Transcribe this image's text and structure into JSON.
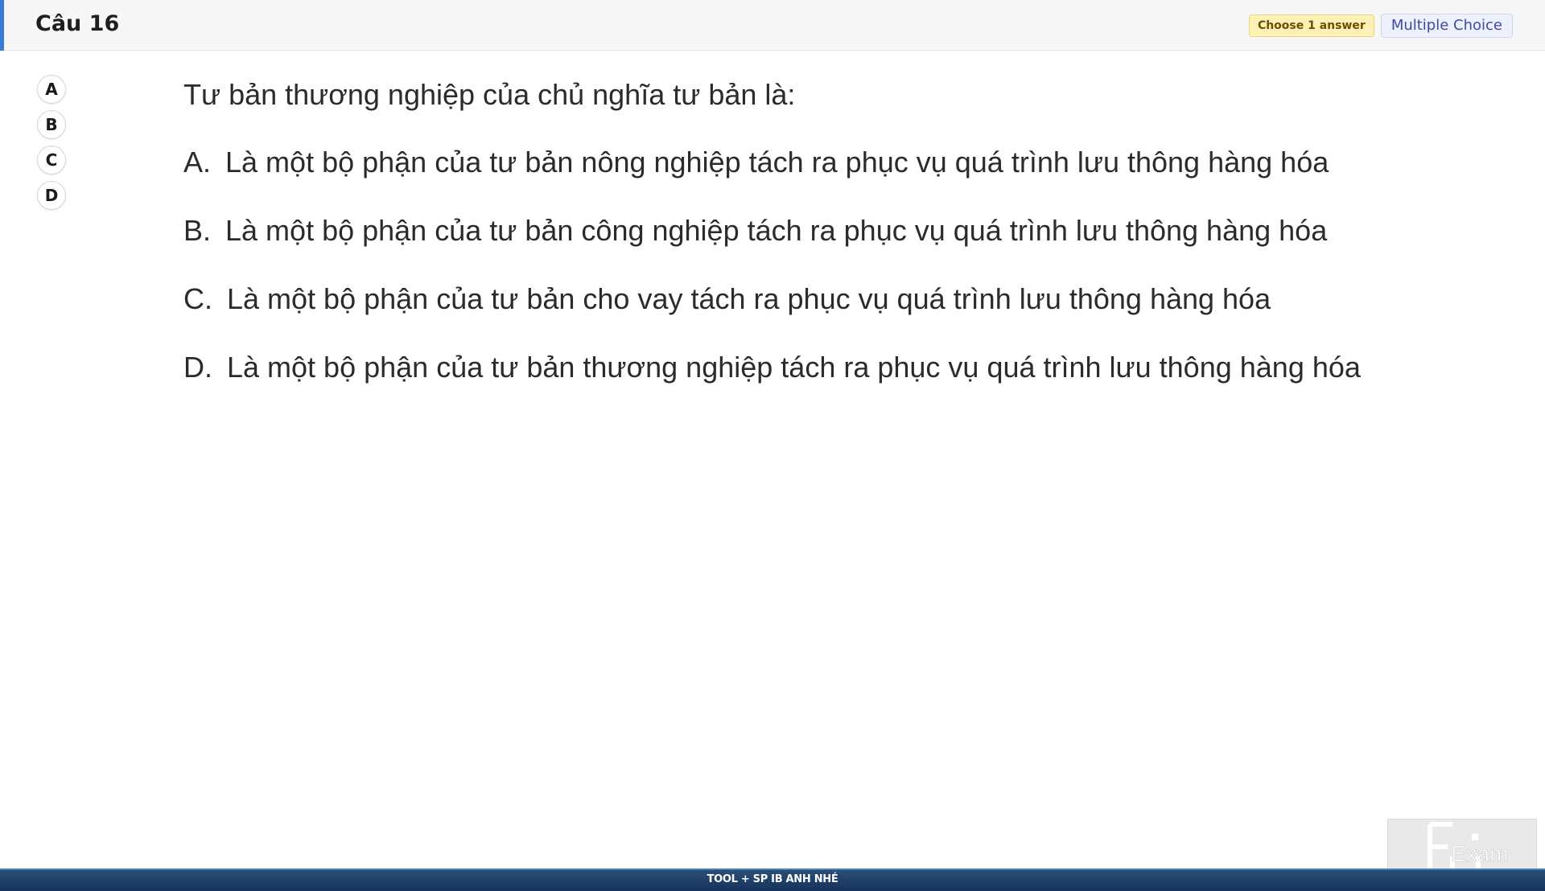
{
  "header": {
    "question_title": "Câu 16",
    "badge_choose": "Choose 1 answer",
    "badge_type": "Multiple Choice",
    "accent_color": "#3a7bd5"
  },
  "answer_options": [
    "A",
    "B",
    "C",
    "D"
  ],
  "question": {
    "stem": "Tư bản thương nghiệp của chủ nghĩa tư bản là:",
    "options": [
      {
        "letter": "A.",
        "text": "Là một bộ phận của tư bản nông nghiệp tách ra phục vụ quá trình lưu thông hàng hóa"
      },
      {
        "letter": "B.",
        "text": "Là một bộ phận của tư bản công nghiệp tách ra phục vụ quá trình lưu thông hàng hóa"
      },
      {
        "letter": "C.",
        "text": "Là một bộ phận của tư bản cho vay tách ra phục vụ quá trình lưu thông hàng hóa"
      },
      {
        "letter": "D.",
        "text": "Là một bộ phận của tư bản thương nghiệp tách ra phục vụ quá trình lưu thông hàng hóa"
      }
    ]
  },
  "footer": {
    "text": "TOOL + SP IB ANH NHÉ"
  },
  "logo": {
    "icon": "fu-exam-logo",
    "text": "Exam"
  }
}
